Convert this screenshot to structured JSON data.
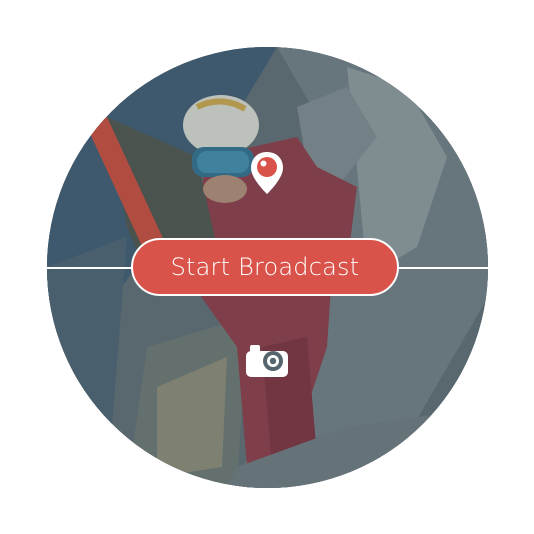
{
  "broadcast": {
    "button_label": "Start Broadcast",
    "accent_color": "#d9534a"
  },
  "icons": {
    "top": "periscope-pin-icon",
    "bottom": "camera-switch-icon"
  },
  "background": {
    "description_color": "#56656d"
  }
}
